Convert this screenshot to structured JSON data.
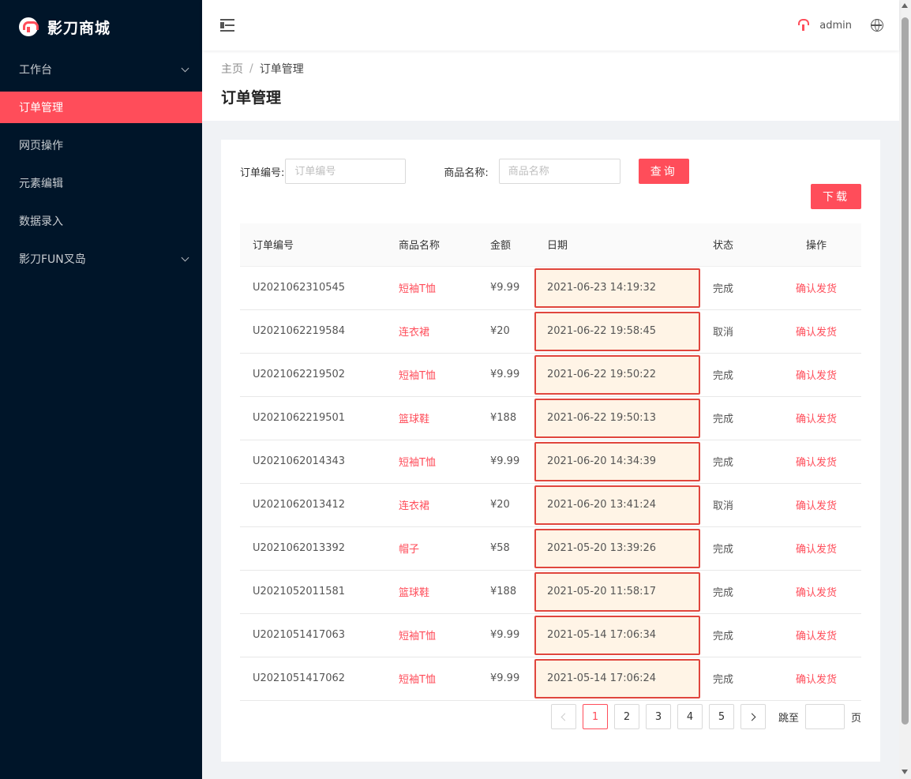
{
  "brand": {
    "name": "影刀商城",
    "logo_icon": "umbrella-logo-icon"
  },
  "sidebar": {
    "items": [
      {
        "label": "工作台",
        "has_submenu": true,
        "active": false
      },
      {
        "label": "订单管理",
        "has_submenu": false,
        "active": true
      },
      {
        "label": "网页操作",
        "has_submenu": false,
        "active": false
      },
      {
        "label": "元素编辑",
        "has_submenu": false,
        "active": false
      },
      {
        "label": "数据录入",
        "has_submenu": false,
        "active": false
      },
      {
        "label": "影刀FUN叉岛",
        "has_submenu": true,
        "active": false
      }
    ]
  },
  "header": {
    "username": "admin",
    "menu_fold_icon": "menu-fold-icon",
    "language_icon": "globe-icon"
  },
  "breadcrumb": {
    "home": "主页",
    "separator": "/",
    "current": "订单管理"
  },
  "page_title": "订单管理",
  "search": {
    "order_label": "订单编号:",
    "order_placeholder": "订单编号",
    "product_label": "商品名称:",
    "product_placeholder": "商品名称",
    "query_button": "查询",
    "download_button": "下载"
  },
  "table": {
    "columns": [
      "订单编号",
      "商品名称",
      "金额",
      "日期",
      "状态",
      "操作"
    ],
    "rows": [
      {
        "order_no": "U2021062310545",
        "product": "短袖T恤",
        "amount": "¥9.99",
        "date": "2021-06-23 14:19:32",
        "status": "完成",
        "action": "确认发货"
      },
      {
        "order_no": "U2021062219584",
        "product": "连衣裙",
        "amount": "¥20",
        "date": "2021-06-22 19:58:45",
        "status": "取消",
        "action": "确认发货"
      },
      {
        "order_no": "U2021062219502",
        "product": "短袖T恤",
        "amount": "¥9.99",
        "date": "2021-06-22 19:50:22",
        "status": "完成",
        "action": "确认发货"
      },
      {
        "order_no": "U2021062219501",
        "product": "篮球鞋",
        "amount": "¥188",
        "date": "2021-06-22 19:50:13",
        "status": "完成",
        "action": "确认发货"
      },
      {
        "order_no": "U2021062014343",
        "product": "短袖T恤",
        "amount": "¥9.99",
        "date": "2021-06-20 14:34:39",
        "status": "完成",
        "action": "确认发货"
      },
      {
        "order_no": "U2021062013412",
        "product": "连衣裙",
        "amount": "¥20",
        "date": "2021-06-20 13:41:24",
        "status": "取消",
        "action": "确认发货"
      },
      {
        "order_no": "U2021062013392",
        "product": "帽子",
        "amount": "¥58",
        "date": "2021-05-20 13:39:26",
        "status": "完成",
        "action": "确认发货"
      },
      {
        "order_no": "U2021052011581",
        "product": "篮球鞋",
        "amount": "¥188",
        "date": "2021-05-20 11:58:17",
        "status": "完成",
        "action": "确认发货"
      },
      {
        "order_no": "U2021051417063",
        "product": "短袖T恤",
        "amount": "¥9.99",
        "date": "2021-05-14 17:06:34",
        "status": "完成",
        "action": "确认发货"
      },
      {
        "order_no": "U2021051417062",
        "product": "短袖T恤",
        "amount": "¥9.99",
        "date": "2021-05-14 17:06:24",
        "status": "完成",
        "action": "确认发货"
      }
    ]
  },
  "pagination": {
    "pages": [
      "1",
      "2",
      "3",
      "4",
      "5"
    ],
    "current": "1",
    "jump_label": "跳至",
    "jump_suffix": "页",
    "jump_value": ""
  },
  "colors": {
    "accent": "#ff4d5a",
    "sidebar_bg": "#001529",
    "date_highlight_border": "#e0463d",
    "date_highlight_bg": "#fff4e6"
  }
}
